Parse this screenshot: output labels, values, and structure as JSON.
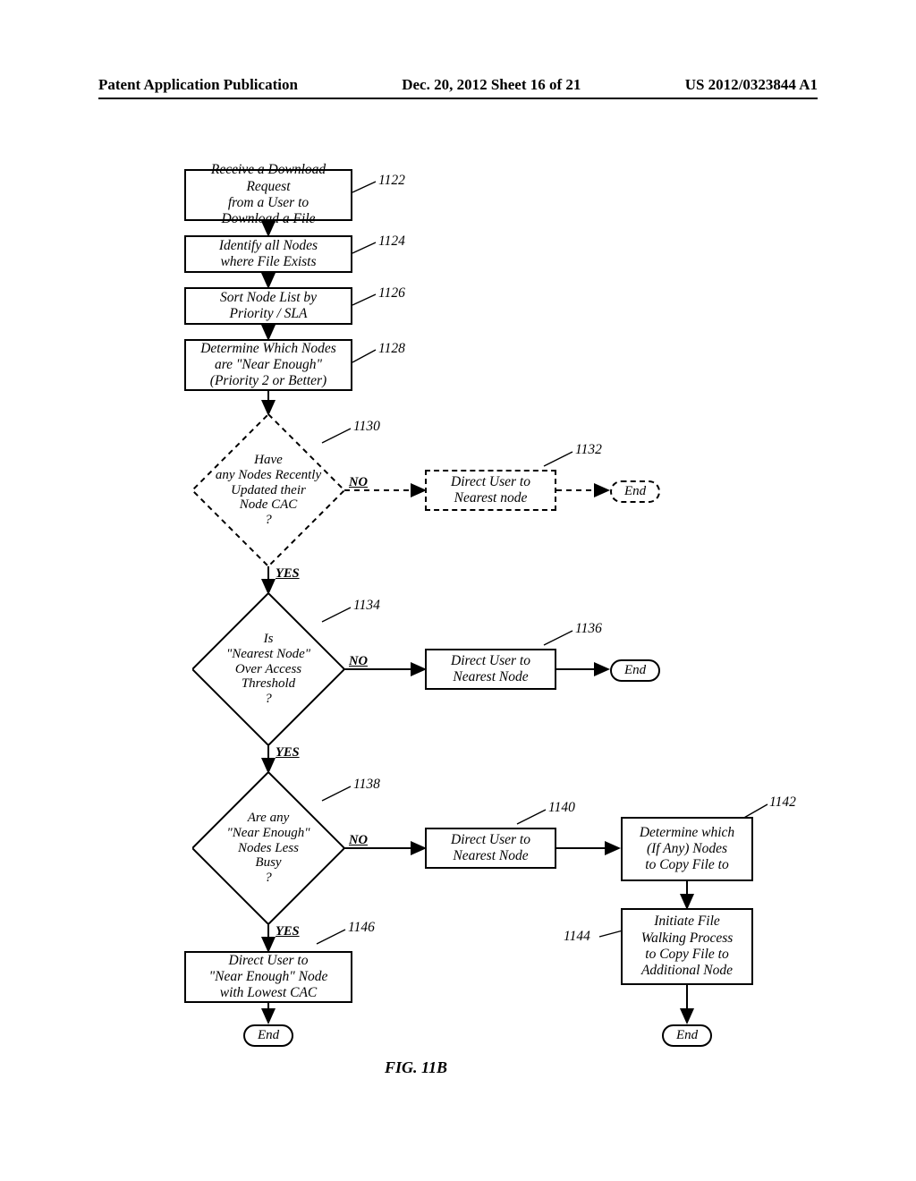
{
  "header": {
    "left": "Patent Application Publication",
    "center": "Dec. 20, 2012  Sheet 16 of 21",
    "right": "US 2012/0323844 A1"
  },
  "boxes": {
    "b1122": "Receive a Download Request\nfrom a User to\nDownload a File",
    "b1124": "Identify all Nodes\nwhere File Exists",
    "b1126": "Sort Node List by\nPriority / SLA",
    "b1128": "Determine Which Nodes\nare \"Near Enough\"\n(Priority 2 or Better)",
    "b1132": "Direct User to\nNearest node",
    "b1136": "Direct User to\nNearest Node",
    "b1140": "Direct User to\nNearest Node",
    "b1142": "Determine which\n(If Any) Nodes\nto Copy File to",
    "b1144": "Initiate File\nWalking Process\nto Copy File to\nAdditional Node",
    "b1146": "Direct User to\n\"Near Enough\" Node\nwith Lowest CAC"
  },
  "diamonds": {
    "d1130": "Have\nany Nodes Recently\nUpdated their\nNode CAC\n?",
    "d1134": "Is\n\"Nearest Node\"\nOver Access\nThreshold\n?",
    "d1138": "Are any\n\"Near Enough\"\nNodes Less\nBusy\n?"
  },
  "labels": {
    "yes": "YES",
    "no": "NO",
    "end": "End"
  },
  "refs": {
    "r1122": "1122",
    "r1124": "1124",
    "r1126": "1126",
    "r1128": "1128",
    "r1130": "1130",
    "r1132": "1132",
    "r1134": "1134",
    "r1136": "1136",
    "r1138": "1138",
    "r1140": "1140",
    "r1142": "1142",
    "r1144": "1144",
    "r1146": "1146"
  },
  "figure_caption": "FIG. 11B"
}
